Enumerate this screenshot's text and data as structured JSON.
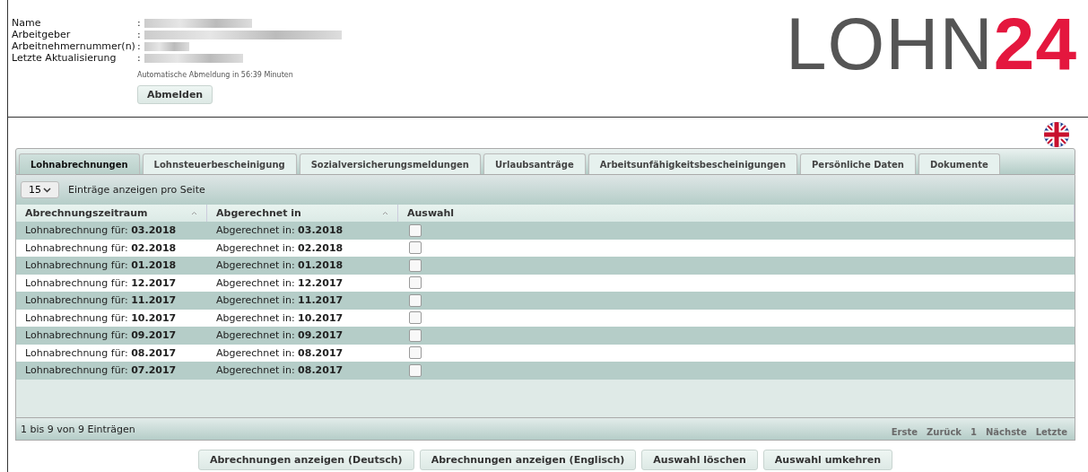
{
  "user_info": {
    "fields": [
      {
        "label": "Name"
      },
      {
        "label": "Arbeitgeber"
      },
      {
        "label": "Arbeitnehmernummer(n)"
      },
      {
        "label": "Letzte Aktualisierung"
      }
    ],
    "separator": ":",
    "auto_logout": "Automatische Abmeldung in 56:39 Minuten",
    "logout_button": "Abmelden"
  },
  "logo": {
    "text": "LOHN",
    "accent": "24"
  },
  "tabs": [
    {
      "label": "Lohnabrechnungen",
      "selected": true
    },
    {
      "label": "Lohnsteuerbescheinigung",
      "selected": false
    },
    {
      "label": "Sozialversicherungsmeldungen",
      "selected": false
    },
    {
      "label": "Urlaubsanträge",
      "selected": false
    },
    {
      "label": "Arbeitsunfähigkeitsbescheinigungen",
      "selected": false
    },
    {
      "label": "Persönliche Daten",
      "selected": false
    },
    {
      "label": "Dokumente",
      "selected": false
    }
  ],
  "page_size": {
    "value": "15",
    "label": "Einträge anzeigen pro Seite"
  },
  "table": {
    "columns": [
      "Abrechnungszeitraum",
      "Abgerechnet in",
      "Auswahl"
    ],
    "rows": [
      {
        "period": "Lohnabrechnung für: **03.2018**",
        "billed": "Abgerechnet in: **03.2018**",
        "checked": false
      },
      {
        "period": "Lohnabrechnung für: **02.2018**",
        "billed": "Abgerechnet in: **02.2018**",
        "checked": false
      },
      {
        "period": "Lohnabrechnung für: **01.2018**",
        "billed": "Abgerechnet in: **01.2018**",
        "checked": false
      },
      {
        "period": "Lohnabrechnung für: **12.2017**",
        "billed": "Abgerechnet in: **12.2017**",
        "checked": false
      },
      {
        "period": "Lohnabrechnung für: **11.2017**",
        "billed": "Abgerechnet in: **11.2017**",
        "checked": false
      },
      {
        "period": "Lohnabrechnung für: **10.2017**",
        "billed": "Abgerechnet in: **10.2017**",
        "checked": false
      },
      {
        "period": "Lohnabrechnung für: **09.2017**",
        "billed": "Abgerechnet in: **09.2017**",
        "checked": false
      },
      {
        "period": "Lohnabrechnung für: **08.2017**",
        "billed": "Abgerechnet in: **08.2017**",
        "checked": false
      },
      {
        "period": "Lohnabrechnung für: **07.2017**",
        "billed": "Abgerechnet in: **08.2017**",
        "checked": false
      }
    ]
  },
  "footer": {
    "info": "1 bis 9 von 9 Einträgen",
    "pager": [
      {
        "label": "Erste",
        "disabled": true
      },
      {
        "label": "Zurück",
        "disabled": true
      },
      {
        "label": "1",
        "disabled": true
      },
      {
        "label": "Nächste",
        "disabled": true
      },
      {
        "label": "Letzte",
        "disabled": true
      }
    ]
  },
  "actions": [
    "Abrechnungen anzeigen (Deutsch)",
    "Abrechnungen anzeigen (Englisch)",
    "Auswahl löschen",
    "Auswahl umkehren"
  ]
}
